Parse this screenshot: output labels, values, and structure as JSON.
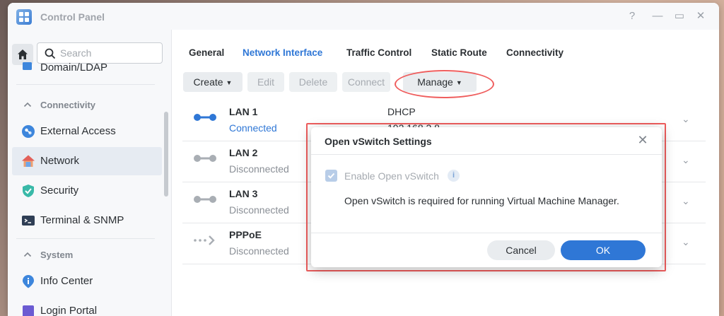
{
  "window": {
    "title": "Control Panel"
  },
  "titlebar_buttons": {
    "help": "?",
    "minimize": "—",
    "maximize": "▭",
    "close": "✕"
  },
  "sidebar": {
    "search_placeholder": "Search",
    "partial_item": "Domain/LDAP",
    "sections": [
      {
        "label": "Connectivity",
        "items": [
          {
            "label": "External Access",
            "icon": "external-access-icon"
          },
          {
            "label": "Network",
            "icon": "network-house-icon",
            "active": true
          },
          {
            "label": "Security",
            "icon": "shield-icon"
          },
          {
            "label": "Terminal & SNMP",
            "icon": "terminal-icon"
          }
        ]
      },
      {
        "label": "System",
        "items": [
          {
            "label": "Info Center",
            "icon": "info-icon"
          },
          {
            "label": "Login Portal",
            "icon": "login-portal-icon"
          }
        ]
      }
    ]
  },
  "tabs": [
    {
      "label": "General"
    },
    {
      "label": "Network Interface",
      "active": true
    },
    {
      "label": "Traffic Control"
    },
    {
      "label": "Static Route"
    },
    {
      "label": "Connectivity"
    }
  ],
  "toolbar": {
    "create": "Create",
    "edit": "Edit",
    "delete": "Delete",
    "connect": "Connect",
    "manage": "Manage"
  },
  "interfaces": [
    {
      "name": "LAN 1",
      "status": "Connected",
      "mode": "DHCP",
      "ip": "192.168.2.8"
    },
    {
      "name": "LAN 2",
      "status": "Disconnected"
    },
    {
      "name": "LAN 3",
      "status": "Disconnected"
    },
    {
      "name": "PPPoE",
      "status": "Disconnected"
    }
  ],
  "dialog": {
    "title": "Open vSwitch Settings",
    "checkbox_label": "Enable Open vSwitch",
    "checkbox_checked": true,
    "info_glyph": "i",
    "message": "Open vSwitch is required for running Virtual Machine Manager.",
    "cancel": "Cancel",
    "ok": "OK"
  },
  "colors": {
    "accent": "#2f77d6",
    "annotation": "#ef5d5d"
  }
}
